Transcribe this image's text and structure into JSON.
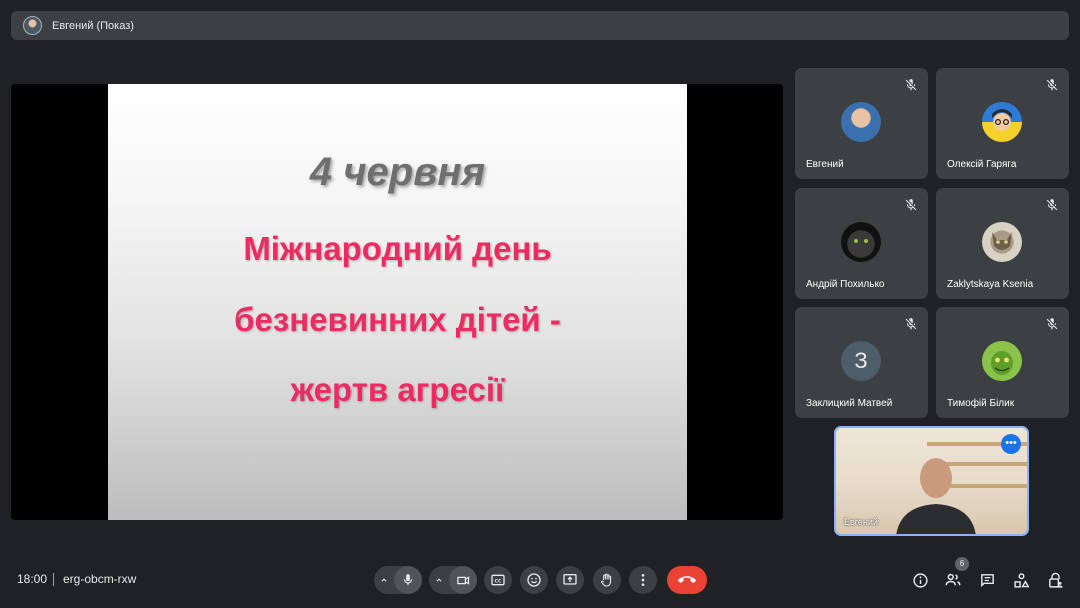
{
  "presenter_bar": {
    "label": "Евгений (Показ)"
  },
  "slide": {
    "date": "4 червня",
    "line1": "Міжнародний день",
    "line2": "безневинних дітей -",
    "line3": "жертв агресії"
  },
  "participants": [
    {
      "name": "Евгений",
      "avatar": "photo-man-icon",
      "mic": "muted"
    },
    {
      "name": "Олексій Гаряга",
      "avatar": "cartoon-avatar-icon",
      "mic": "muted"
    },
    {
      "name": "Андрій Похилько",
      "avatar": "dark-cat-photo-icon",
      "mic": "muted"
    },
    {
      "name": "Zaklytskaya Ksenia",
      "avatar": "cat-photo-icon",
      "mic": "muted"
    },
    {
      "name": "Заклицкий Матвей",
      "avatar_letter": "З",
      "mic": "muted"
    },
    {
      "name": "Тимофій Білик",
      "avatar": "green-character-icon",
      "mic": "muted"
    }
  ],
  "self_view": {
    "name": "Евгений"
  },
  "meeting": {
    "time": "18:00",
    "code": "erg-obcm-rxw"
  },
  "people_count": "6",
  "colors": {
    "accent": "#8ab4f8",
    "end_call": "#ea4335",
    "slide_text": "#ee2a63"
  }
}
